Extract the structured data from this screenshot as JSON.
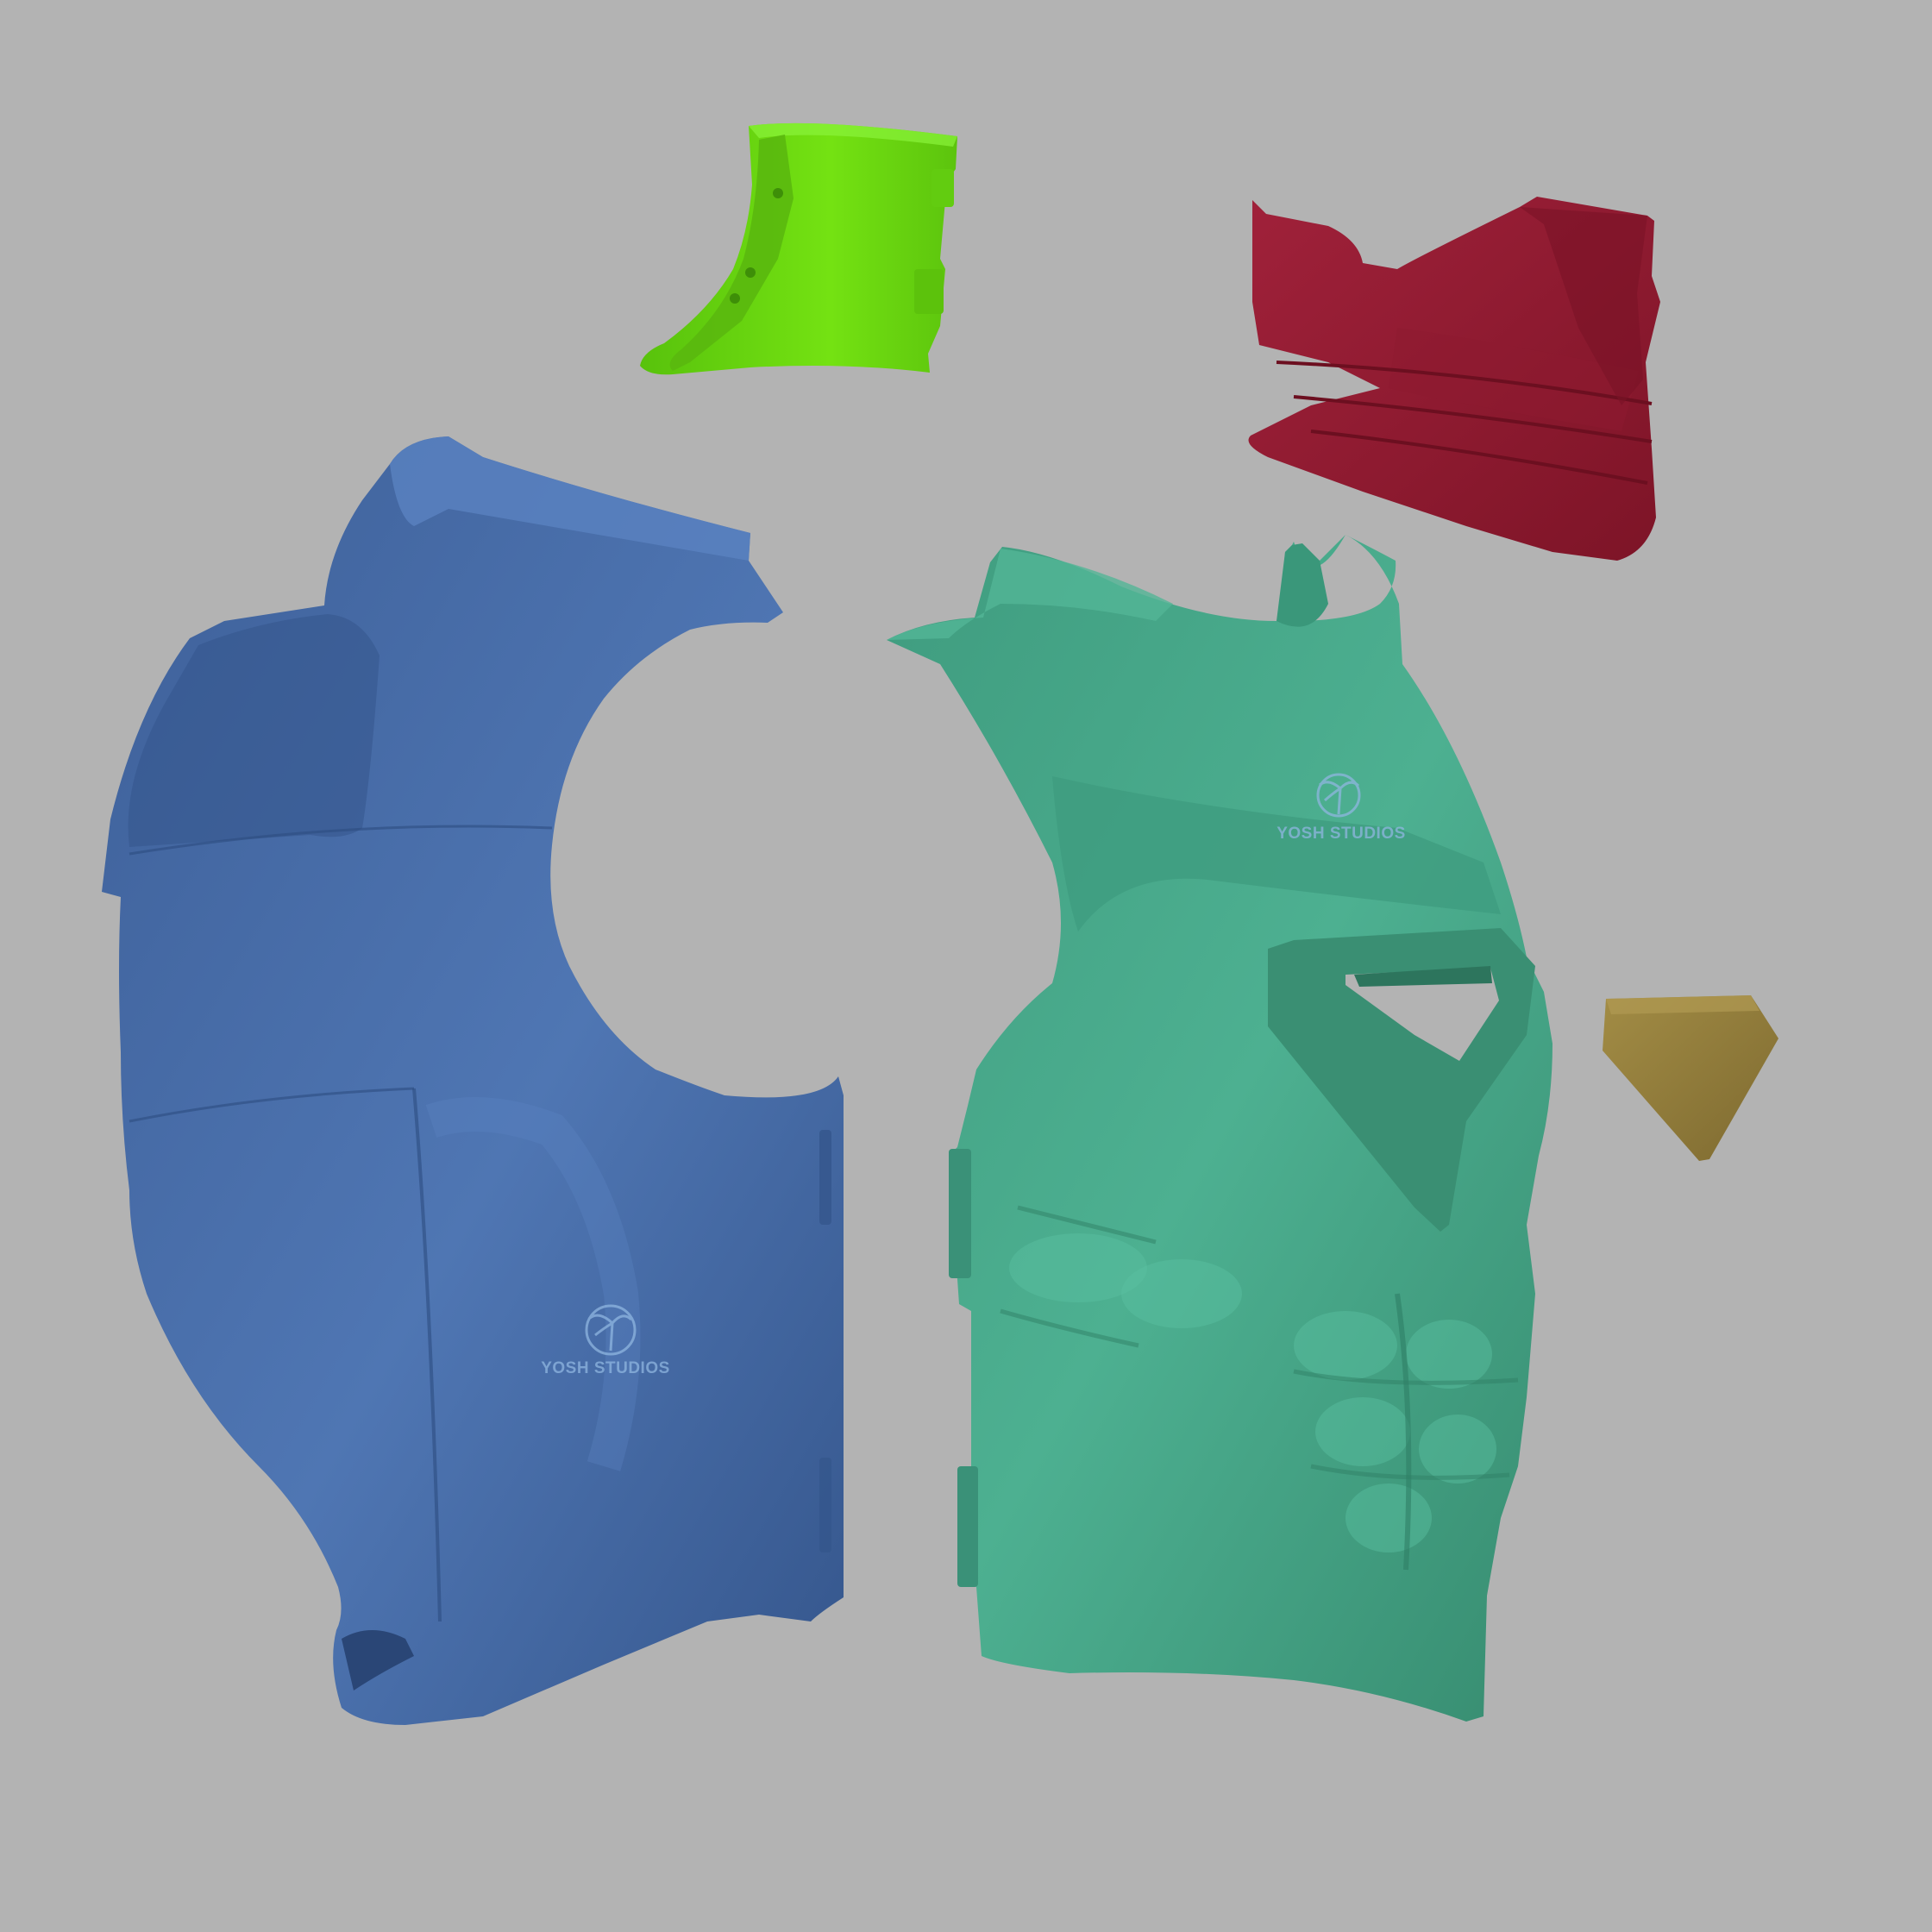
{
  "scene": {
    "background": "#b3b3b3"
  },
  "parts": [
    {
      "name": "back-armor-piece",
      "color": "#4a6ea8",
      "shade": "#2f4d80",
      "highlight": "#5f86c4"
    },
    {
      "name": "chest-armor-piece",
      "color": "#45a588",
      "shade": "#2f7f66",
      "highlight": "#5cbfa0"
    },
    {
      "name": "shoulder-collar-piece",
      "color": "#6cd80f",
      "shade": "#4aa80a",
      "highlight": "#86ec2c"
    },
    {
      "name": "neck-collar-piece",
      "color": "#9a1c33",
      "shade": "#6e1022",
      "highlight": "#b22c46"
    },
    {
      "name": "gem-piece",
      "color": "#8f7a3a",
      "shade": "#6e5d2a",
      "highlight": "#a38c46"
    }
  ],
  "watermark": {
    "text": "YOSH STUDIOS",
    "icon": "palm-tree-circle-icon",
    "color": "#8fb6e0"
  }
}
